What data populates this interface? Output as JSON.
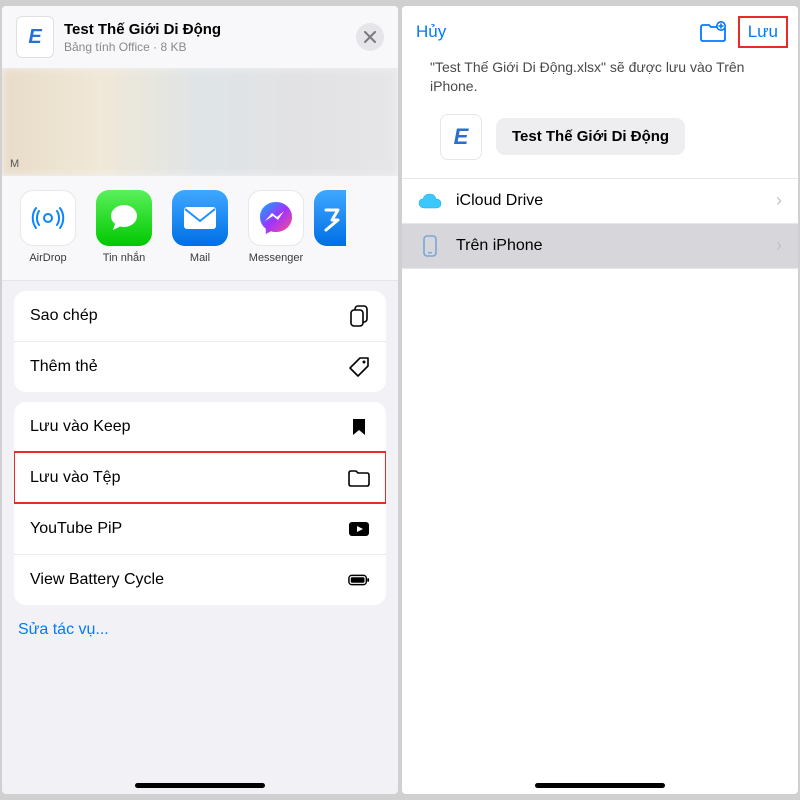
{
  "left": {
    "file": {
      "title": "Test Thế Giới Di Động",
      "subtitle": "Bảng tính Office · 8 KB",
      "thumb_letter": "E"
    },
    "people_label": "M",
    "apps": [
      {
        "name": "AirDrop"
      },
      {
        "name": "Tin nhắn"
      },
      {
        "name": "Mail"
      },
      {
        "name": "Messenger"
      }
    ],
    "actions_a": [
      {
        "label": "Sao chép",
        "icon": "copy"
      },
      {
        "label": "Thêm thẻ",
        "icon": "tag"
      }
    ],
    "actions_b": [
      {
        "label": "Lưu vào Keep",
        "icon": "bookmark"
      },
      {
        "label": "Lưu vào Tệp",
        "icon": "folder",
        "highlight": true
      },
      {
        "label": "YouTube PiP",
        "icon": "play"
      },
      {
        "label": "View Battery Cycle",
        "icon": "battery"
      }
    ],
    "edit": "Sửa tác vụ..."
  },
  "right": {
    "cancel": "Hủy",
    "save": "Lưu",
    "desc": "\"Test Thế Giới Di Động.xlsx\" sẽ được lưu vào Trên iPhone.",
    "file_name": "Test Thế Giới Di Động",
    "thumb_letter": "E",
    "locations": [
      {
        "label": "iCloud Drive",
        "icon": "cloud",
        "selected": false
      },
      {
        "label": "Trên iPhone",
        "icon": "phone",
        "selected": true
      }
    ]
  }
}
